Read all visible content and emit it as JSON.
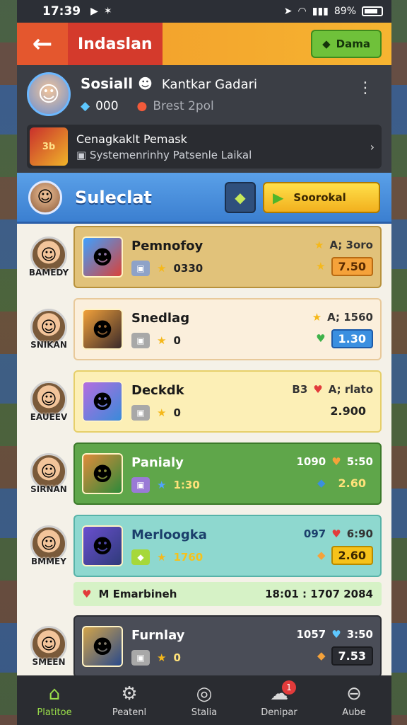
{
  "status": {
    "time": "17:39",
    "icons_left": [
      "play-store",
      "notification"
    ],
    "battery": "89%"
  },
  "appbar": {
    "back_icon": "←",
    "title": "Indaslan",
    "action_label": "Dama"
  },
  "profile": {
    "name": "Sosiall",
    "subtitle": "Kantkar Gadari",
    "gems": "000",
    "coins": "Brest 2pol",
    "notice_badge": "3b",
    "notice_title": "Cenagkaklt Pemask",
    "notice_text": "Systemenrinhy Patsenle Laikal"
  },
  "section": {
    "title": "Suleclat",
    "button_label": "Soorokal"
  },
  "rows": [
    {
      "user": "BAMEDY",
      "title": "Pemnofoy",
      "stat": "0330",
      "r1": "A; 3oro",
      "r2": "7.50",
      "r1_icon": "★",
      "r2_icon": "★"
    },
    {
      "user": "SNIKAN",
      "title": "Snedlag",
      "stat": "0",
      "r1": "A; 1560",
      "r2": "1.30",
      "r1_icon": "★",
      "r2_icon": "♥"
    },
    {
      "user": "EAUEEV",
      "title": "Deckdk",
      "stat": "0",
      "lead": "B3",
      "r1": "A; rlato",
      "r2": "2.900",
      "r1_icon": "♥"
    },
    {
      "user": "SIRNAN",
      "title": "Panialy",
      "stat": "1:30",
      "lead": "1090",
      "r1": "5:50",
      "r2": "2.60",
      "r1_icon": "♥",
      "r2_icon": "◆"
    },
    {
      "user": "BMMEY",
      "title": "Merloogka",
      "stat": "1760",
      "lead": "097",
      "r1": "6:90",
      "r2": "2.60",
      "r1_icon": "♥",
      "r2_icon": "◆"
    },
    {
      "user": "SMEEN",
      "title": "Furnlay",
      "stat": "0",
      "lead": "1057",
      "r1": "3:50",
      "r2": "7.53",
      "r1_icon": "♥",
      "r2_icon": "◆"
    }
  ],
  "strip": {
    "label": "M Emarbineh",
    "time": "18:01 : 1707 2084"
  },
  "nav": [
    {
      "label": "Platitoe",
      "icon": "home-icon"
    },
    {
      "label": "Peatenl",
      "icon": "gear-icon"
    },
    {
      "label": "Stalia",
      "icon": "target-icon"
    },
    {
      "label": "Denipar",
      "icon": "chat-icon",
      "badge": "1"
    },
    {
      "label": "Aube",
      "icon": "menu-icon"
    }
  ]
}
